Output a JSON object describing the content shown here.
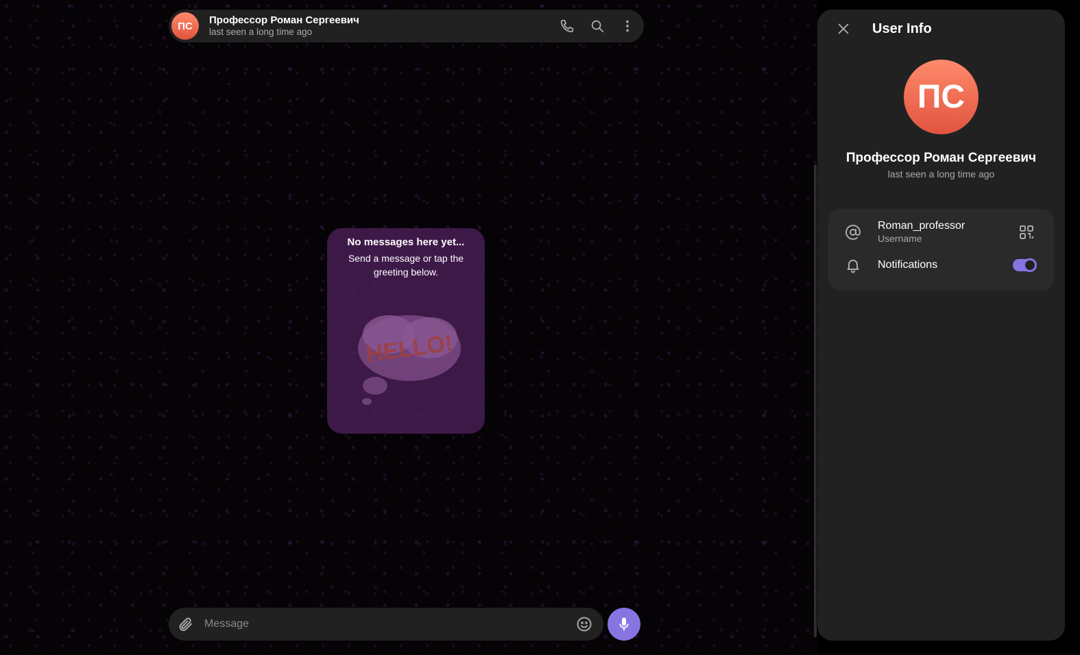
{
  "chat": {
    "contact_name": "Профессор Роман Сергеевич",
    "contact_initials": "ПС",
    "contact_status": "last seen a long time ago",
    "header_icons": [
      "phone-icon",
      "search-icon",
      "more-vertical-icon"
    ]
  },
  "empty_state": {
    "title": "No messages here yet...",
    "text": "Send a message or tap the greeting below.",
    "sticker_text": "HELLO!"
  },
  "composer": {
    "placeholder": "Message"
  },
  "user_info": {
    "title": "User Info",
    "initials": "ПС",
    "name": "Профессор Роман Сергеевич",
    "status": "last seen a long time ago",
    "username": "Roman_professor",
    "username_label": "Username",
    "notifications_label": "Notifications",
    "notifications_enabled": true
  },
  "colors": {
    "accent": "#8774e1",
    "avatar": "#e8654d",
    "panel_bg": "#212121",
    "empty_card": "#4a1e58"
  }
}
